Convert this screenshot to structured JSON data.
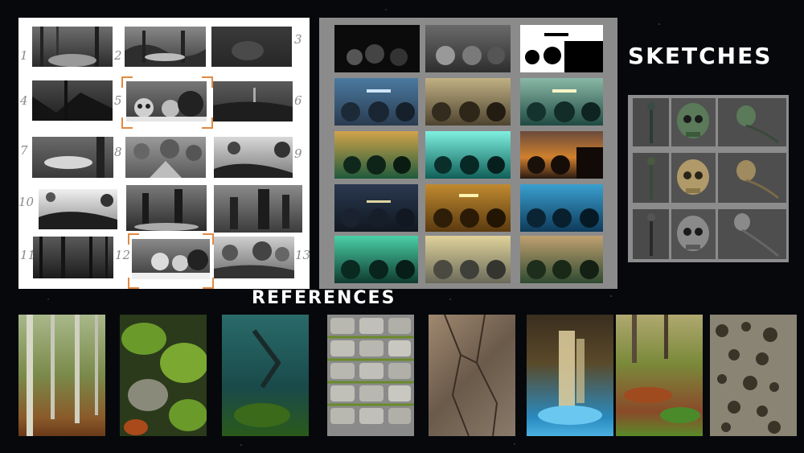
{
  "headings": {
    "sketches": "SKETCHES",
    "references": "REFERENCES"
  },
  "sketch_numbers": [
    "1",
    "2",
    "3",
    "4",
    "5",
    "6",
    "7",
    "8",
    "9",
    "10",
    "11",
    "12",
    "13"
  ],
  "colors": {
    "background": "#07080c",
    "sketch_panel": "#ffffff",
    "color_panel": "#8b8b8b",
    "skull_panel": "#8c8c8c",
    "selection_accent": "#e28a42",
    "number_color": "#8a8a8a"
  },
  "reference_images": [
    "birch-forest-photo",
    "mossy-rocks-photo",
    "dark-teal-forest-photo",
    "mossy-cobblestone-photo",
    "cracked-rock-photo",
    "cave-waterfall-photo",
    "autumn-forest-floor-photo",
    "porous-organic-texture-photo"
  ]
}
